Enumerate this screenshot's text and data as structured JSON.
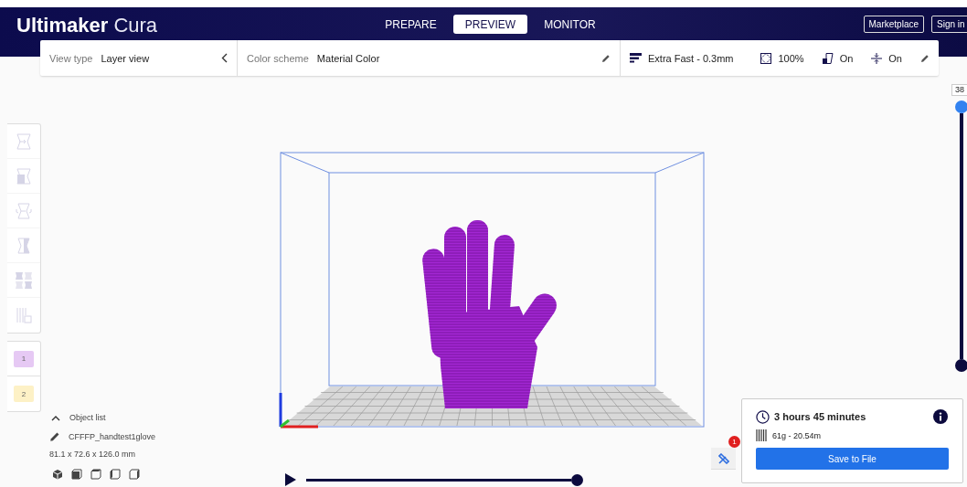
{
  "header": {
    "logo_bold": "Ultimaker",
    "logo_light": "Cura",
    "tabs": [
      {
        "label": "PREPARE",
        "selected": false
      },
      {
        "label": "PREVIEW",
        "selected": true
      },
      {
        "label": "MONITOR",
        "selected": false
      }
    ],
    "buttons": [
      "Marketplace",
      "Sign in"
    ]
  },
  "toolbar": {
    "view_type": {
      "label": "View type",
      "value": "Layer view"
    },
    "color_scheme": {
      "label": "Color scheme",
      "value": "Material Color"
    },
    "print_setup": {
      "profile": "Extra Fast - 0.3mm",
      "infill": "100%",
      "support": "On",
      "adhesion": "On"
    }
  },
  "tools": [
    {
      "kind": "move",
      "disabled": true
    },
    {
      "kind": "scale",
      "disabled": true
    },
    {
      "kind": "rotate",
      "disabled": true
    },
    {
      "kind": "mirror",
      "disabled": true
    },
    {
      "kind": "per-model",
      "disabled": true
    },
    {
      "kind": "support-blocker",
      "disabled": true
    }
  ],
  "extruders": [
    {
      "label": "1",
      "color": "#e6c9f4"
    },
    {
      "label": "2",
      "color": "#fdf1c6"
    }
  ],
  "layer_slider": {
    "label": "38"
  },
  "object_list": {
    "title": "Object list",
    "expanded": true,
    "name": "CFFFP_handtest1glove",
    "dimensions": "81.1 x 72.6 x 126.0 mm"
  },
  "tools_badge": "1",
  "print_info": {
    "time": "3 hours 45 minutes",
    "material": "61g - 20.54m",
    "button": "Save to File"
  }
}
